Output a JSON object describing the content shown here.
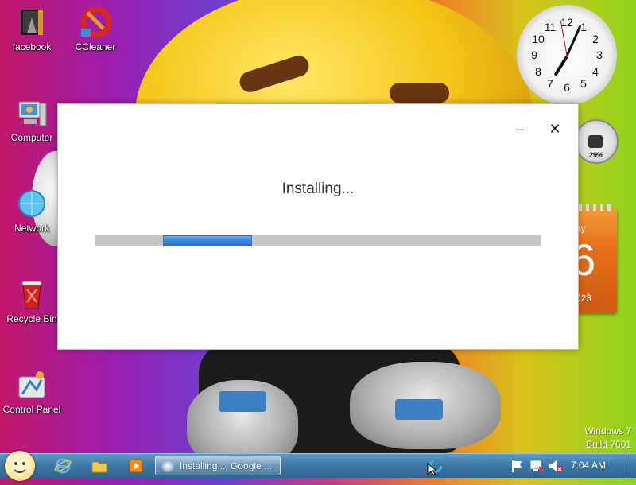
{
  "desktop": {
    "icons": [
      {
        "label": "facebook"
      },
      {
        "label": "CCleaner"
      },
      {
        "label": "Computer"
      },
      {
        "label": "Network"
      },
      {
        "label": "Recycle Bin"
      },
      {
        "label": "Control Panel"
      }
    ],
    "watermark": {
      "line1": "Windows 7",
      "line2": "Build 7601"
    }
  },
  "gadgets": {
    "clock": {
      "numbers": [
        "12",
        "1",
        "2",
        "3",
        "4",
        "5",
        "6",
        "7",
        "8",
        "9",
        "10",
        "11"
      ],
      "time_shown": "7:04"
    },
    "meter": {
      "percent": "29%"
    },
    "calendar": {
      "day_fragment": "ay",
      "date_fragment": "6",
      "year_fragment": "023"
    }
  },
  "installer": {
    "status_text": "Installing...",
    "progress_value": 0.2,
    "minimize_label": "–",
    "close_label": "✕"
  },
  "taskbar": {
    "task_label": "Installing..., Google ...",
    "clock": "7:04 AM"
  },
  "icons": {
    "start": "start-orb-icon",
    "ie": "internet-explorer-icon",
    "explorer": "folder-icon",
    "media": "media-player-icon",
    "tray": [
      "flag-icon",
      "network-icon",
      "volume-muted-icon"
    ]
  }
}
